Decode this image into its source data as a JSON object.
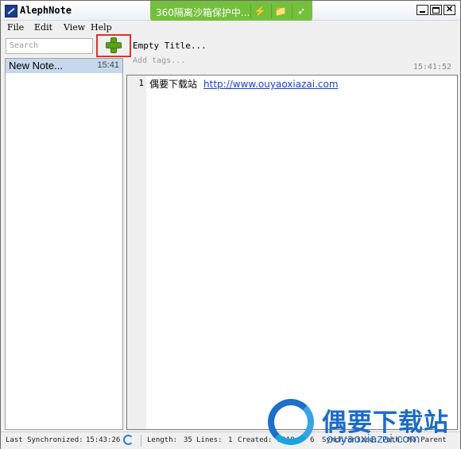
{
  "window": {
    "title": "AlephNote"
  },
  "sandbox": {
    "text": "360隔离沙箱保护中...",
    "icons": [
      "plug-icon",
      "folder-icon",
      "pin-icon"
    ]
  },
  "menu": {
    "items": [
      "File",
      "Edit",
      "View",
      "Help"
    ]
  },
  "sidebar": {
    "search_placeholder": "Search",
    "notes": [
      {
        "title": "New Note...",
        "time": "15:41"
      }
    ]
  },
  "editor": {
    "title_placeholder": "Empty Title...",
    "tags_placeholder": "Add tags...",
    "timestamp": "15:41:52",
    "lines": [
      {
        "number": "1",
        "text": "偶要下载站",
        "link": "http://www.ouyaoxiazai.com"
      }
    ]
  },
  "statusbar": {
    "last_sync_label": "Last Synchronized:",
    "last_sync_time": "15:43:26",
    "length_label": "Length:",
    "length_value": "35",
    "lines_label": "Lines:",
    "lines_value": "1",
    "created_label": "Created:",
    "created_value": "2018-",
    "created_tail": "6",
    "sync_label": "Synchronized:",
    "path_label": "Path:",
    "path_value": "No Parent"
  },
  "watermark": {
    "brand": "偶要下载站",
    "url": "ouyaoxiazai.com"
  },
  "colors": {
    "accent_green": "#74bf3b",
    "selection": "#c5d8ee",
    "highlight_red": "#e0302b",
    "link_blue": "#1a3fd0",
    "watermark_blue": "#1c6cc6"
  }
}
